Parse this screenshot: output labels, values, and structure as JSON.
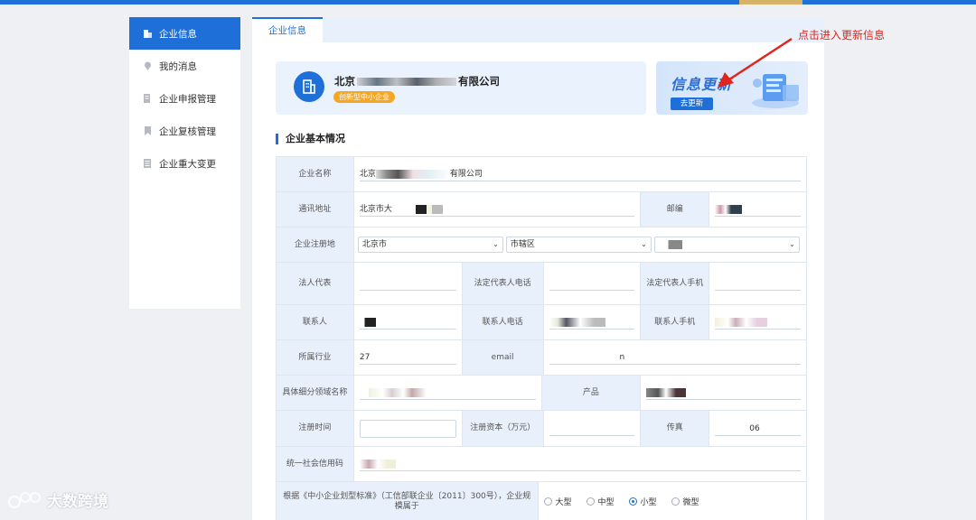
{
  "sidebar": {
    "items": [
      {
        "label": "企业信息",
        "icon": "building-icon",
        "active": true
      },
      {
        "label": "我的消息",
        "icon": "location-pin-icon",
        "active": false
      },
      {
        "label": "企业申报管理",
        "icon": "document-edit-icon",
        "active": false
      },
      {
        "label": "企业复核管理",
        "icon": "bookmark-icon",
        "active": false
      },
      {
        "label": "企业重大变更",
        "icon": "list-icon",
        "active": false
      }
    ]
  },
  "tabs": [
    {
      "label": "企业信息"
    }
  ],
  "company": {
    "name_prefix": "北京",
    "name_suffix": "有限公司",
    "tag": "创新型中小企业"
  },
  "update_card": {
    "title": "信息更新",
    "button": "去更新"
  },
  "annotation": {
    "text": "点击进入更新信息",
    "color": "#e0251b"
  },
  "section_title": "企业基本情况",
  "form": {
    "company_name": {
      "label": "企业名称",
      "value_prefix": "北京",
      "value_suffix": "有限公司"
    },
    "address": {
      "label": "通讯地址",
      "value_prefix": "北京市大"
    },
    "postcode": {
      "label": "邮编"
    },
    "region": {
      "label": "企业注册地",
      "province": "北京市",
      "city": "市辖区"
    },
    "legal_rep": {
      "label": "法人代表"
    },
    "legal_phone": {
      "label": "法定代表人电话"
    },
    "legal_mobile": {
      "label": "法定代表人手机"
    },
    "contact": {
      "label": "联系人"
    },
    "contact_phone": {
      "label": "联系人电话"
    },
    "contact_mobile": {
      "label": "联系人手机"
    },
    "industry": {
      "label": "所属行业",
      "value_prefix": "27"
    },
    "email": {
      "label": "email",
      "value_suffix": "n"
    },
    "subfield": {
      "label": "具体细分领域名称"
    },
    "product": {
      "label": "产品"
    },
    "reg_time": {
      "label": "注册时间"
    },
    "reg_capital": {
      "label": "注册资本（万元）"
    },
    "fax": {
      "label": "传真",
      "value_suffix": "06"
    },
    "credit_code": {
      "label": "统一社会信用码"
    },
    "scale": {
      "label": "根据《中小企业划型标准》（工信部联企业〔2011〕300号），企业规模属于",
      "options": [
        "大型",
        "中型",
        "小型",
        "微型"
      ],
      "selected": "小型"
    }
  },
  "watermark": {
    "text": "大数跨境"
  },
  "colors": {
    "primary": "#1f6fd8",
    "label_bg": "#e8f0fb",
    "tag": "#f5a623"
  }
}
